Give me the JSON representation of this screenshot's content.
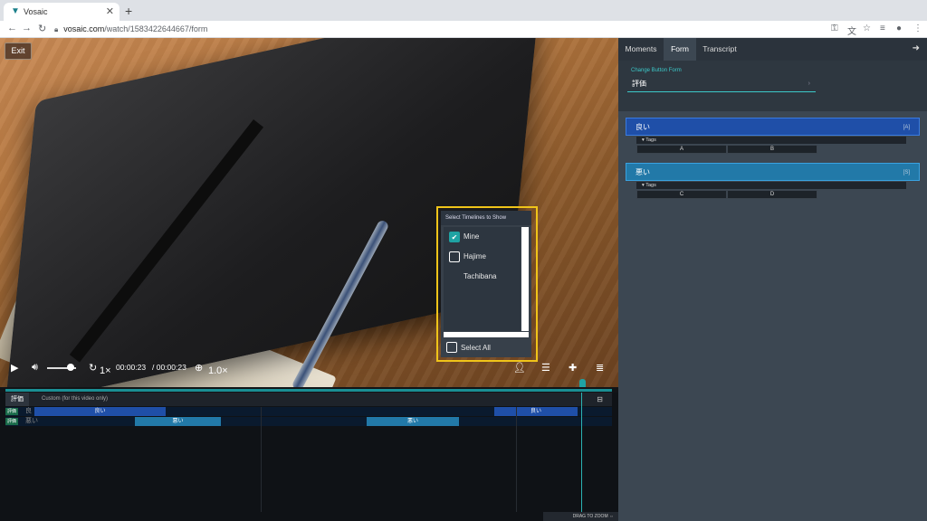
{
  "browser": {
    "tab_title": "Vosaic",
    "tab_close": "✕",
    "new_tab": "+",
    "url_host": "vosaic.com",
    "url_path": "/watch/1583422644667/form",
    "back": "←",
    "forward": "→",
    "reload": "↻"
  },
  "video": {
    "exit_label": "Exit",
    "current_time": "00:00:23",
    "total_time": "/ 00:00:23",
    "replay_speed": "1×",
    "zoom_level": "1.0×"
  },
  "timeline_picker": {
    "header": "Select Timelines to Show",
    "items": [
      {
        "label": "Mine",
        "checked": true
      },
      {
        "label": "Hajime Tachibana",
        "checked": false
      }
    ],
    "select_all": "Select All"
  },
  "timeline": {
    "tabs": [
      "評価",
      "Custom (for this video only)"
    ],
    "rows": [
      {
        "tag": "評価",
        "category": "良",
        "segments": [
          {
            "label": "良い"
          },
          {
            "label": "良い"
          }
        ]
      },
      {
        "tag": "評価",
        "category": "悪い",
        "segments": [
          {
            "label": "悪い"
          },
          {
            "label": "悪い"
          }
        ]
      }
    ],
    "zoom_hint": "DRAG TO ZOOM"
  },
  "panel": {
    "tabs": [
      "Moments",
      "Form",
      "Transcript"
    ],
    "change_form_label": "Change Button Form",
    "form_name": "評価",
    "buttons": [
      {
        "label": "良い",
        "key": "[A]",
        "tags_label": "Tags",
        "tags": [
          "A",
          "B"
        ],
        "color": "#1f4fa8"
      },
      {
        "label": "悪い",
        "key": "[S]",
        "tags_label": "Tags",
        "tags": [
          "C",
          "D"
        ],
        "color": "#2279a8"
      }
    ]
  },
  "colors": {
    "accent": "#1fa3a3",
    "highlight": "#f0c419",
    "panel_bg": "#3c4752"
  }
}
